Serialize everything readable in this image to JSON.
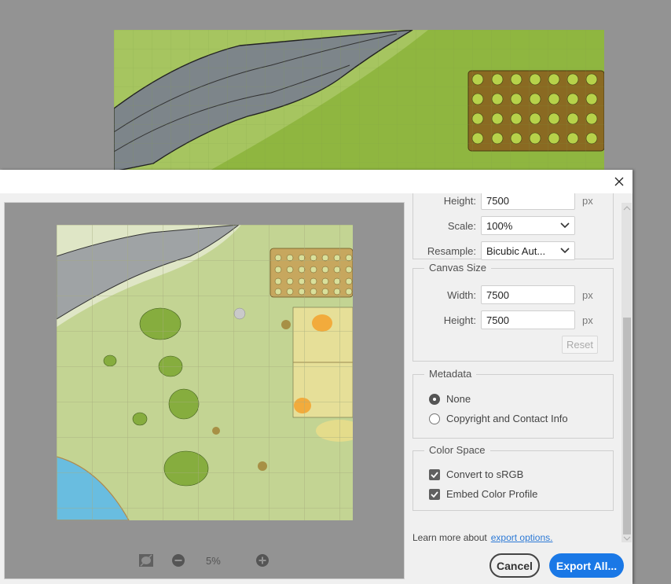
{
  "dialog": {
    "close_label": "Close"
  },
  "preview": {
    "zoom_level": "5%",
    "icons": [
      "toggle-transparency-icon",
      "zoom-out-icon",
      "zoom-in-icon"
    ]
  },
  "image_size": {
    "height_label": "Height:",
    "height_value": "7500",
    "height_unit": "px",
    "scale_label": "Scale:",
    "scale_value": "100%",
    "resample_label": "Resample:",
    "resample_value": "Bicubic Aut..."
  },
  "canvas_size": {
    "title": "Canvas Size",
    "width_label": "Width:",
    "width_value": "7500",
    "width_unit": "px",
    "height_label": "Height:",
    "height_value": "7500",
    "height_unit": "px",
    "reset_label": "Reset"
  },
  "metadata": {
    "title": "Metadata",
    "options": [
      {
        "label": "None",
        "selected": true
      },
      {
        "label": "Copyright and Contact Info",
        "selected": false
      }
    ]
  },
  "color_space": {
    "title": "Color Space",
    "options": [
      {
        "label": "Convert to sRGB",
        "checked": true
      },
      {
        "label": "Embed Color Profile",
        "checked": true
      }
    ]
  },
  "footer": {
    "learn_text": "Learn more about",
    "learn_link": "export options.",
    "cancel_label": "Cancel",
    "export_label": "Export All..."
  },
  "colors": {
    "accent": "#1a78e6",
    "link": "#2d7ad6"
  }
}
